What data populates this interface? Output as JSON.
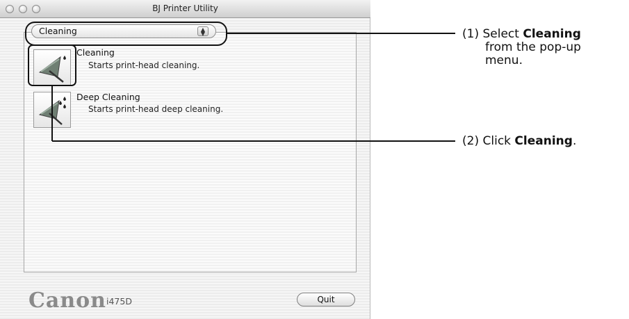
{
  "window": {
    "title": "BJ Printer Utility"
  },
  "popup": {
    "selected": "Cleaning"
  },
  "items": [
    {
      "title": "Cleaning",
      "description": "Starts print-head cleaning.",
      "icon": "cleaning-brush-icon"
    },
    {
      "title": "Deep Cleaning",
      "description": "Starts print-head deep cleaning.",
      "icon": "deep-cleaning-brush-icon"
    }
  ],
  "footer": {
    "brand": "Canon",
    "model": "i475D",
    "quit_label": "Quit"
  },
  "callouts": {
    "step1": {
      "number": "(1)",
      "prefix": "Select ",
      "bold": "Cleaning",
      "line2": "from the pop-up",
      "line3": "menu."
    },
    "step2": {
      "number": "(2)",
      "prefix": "Click ",
      "bold": "Cleaning",
      "suffix": "."
    }
  }
}
